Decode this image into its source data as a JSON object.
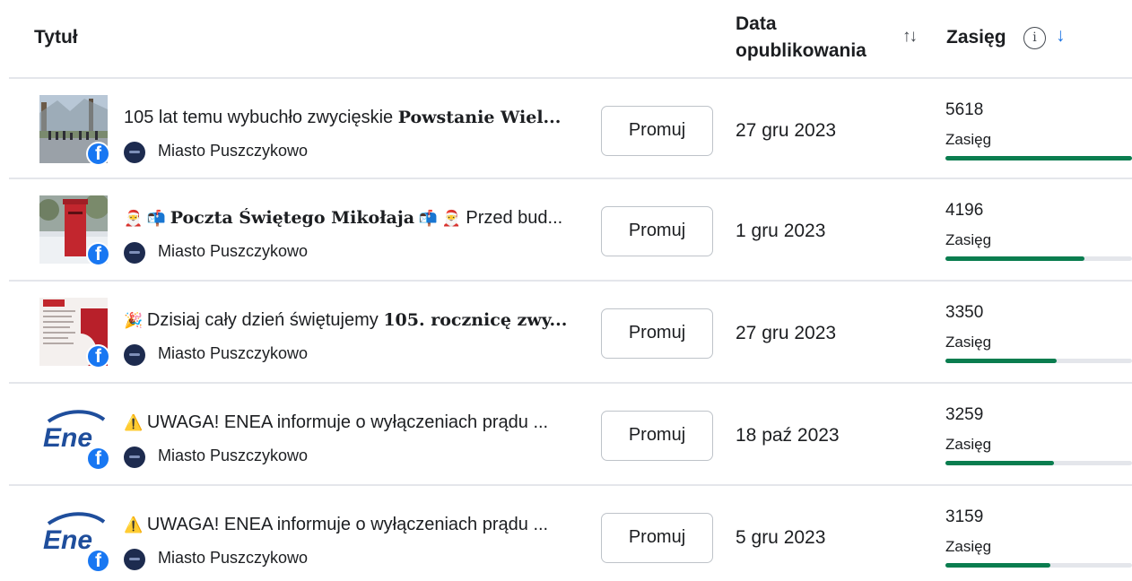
{
  "header": {
    "title_col": "Tytuł",
    "date_col_line1": "Data",
    "date_col_line2": "opublikowania",
    "sort_icon": "sort-arrows-icon",
    "reach_col": "Zasięg",
    "info_icon": "info-icon",
    "info_glyph": "i",
    "sort_desc_icon": "arrow-down-icon"
  },
  "colors": {
    "accent": "#1b74e4",
    "facebook": "#1877f2",
    "bar": "#0a7d4f",
    "divider": "#e4e6eb"
  },
  "posts": [
    {
      "text_plain": "105 lat temu wybuchło zwycięskie ",
      "text_bold": "Powstanie Wiel...",
      "text_after": "",
      "lead_emoji": "",
      "page": "Miasto Puszczykowo",
      "button": "Promuj",
      "date": "27 gru 2023",
      "reach": "5618",
      "reach_label": "Zasięg",
      "reach_fraction": 1.0,
      "thumb": "street-photo"
    },
    {
      "text_plain": "",
      "text_bold": "Poczta Świętego Mikołaja",
      "text_after": " Przed bud...",
      "lead_emoji": "🎅 📬 ",
      "mid_emoji": " 📬 🎅",
      "page": "Miasto Puszczykowo",
      "button": "Promuj",
      "date": "1 gru 2023",
      "reach": "4196",
      "reach_label": "Zasięg",
      "reach_fraction": 0.747,
      "thumb": "mailbox-photo"
    },
    {
      "text_plain": "Dzisiaj cały dzień świętujemy ",
      "text_bold": "105. rocznicę zwy...",
      "text_after": "",
      "lead_emoji": "🎉 ",
      "page": "Miasto Puszczykowo",
      "button": "Promuj",
      "date": "27 gru 2023",
      "reach": "3350",
      "reach_label": "Zasięg",
      "reach_fraction": 0.596,
      "thumb": "poster"
    },
    {
      "text_plain": "UWAGA! ENEA informuje o wyłączeniach prądu ...",
      "text_bold": "",
      "text_after": "",
      "lead_emoji": "⚠️ ",
      "page": "Miasto Puszczykowo",
      "button": "Promuj",
      "date": "18 paź 2023",
      "reach": "3259",
      "reach_label": "Zasięg",
      "reach_fraction": 0.58,
      "thumb": "enea-logo"
    },
    {
      "text_plain": "UWAGA! ENEA informuje o wyłączeniach prądu ...",
      "text_bold": "",
      "text_after": "",
      "lead_emoji": "⚠️ ",
      "page": "Miasto Puszczykowo",
      "button": "Promuj",
      "date": "5 gru 2023",
      "reach": "3159",
      "reach_label": "Zasięg",
      "reach_fraction": 0.562,
      "thumb": "enea-logo"
    }
  ],
  "enea_logo_text": "Ene"
}
